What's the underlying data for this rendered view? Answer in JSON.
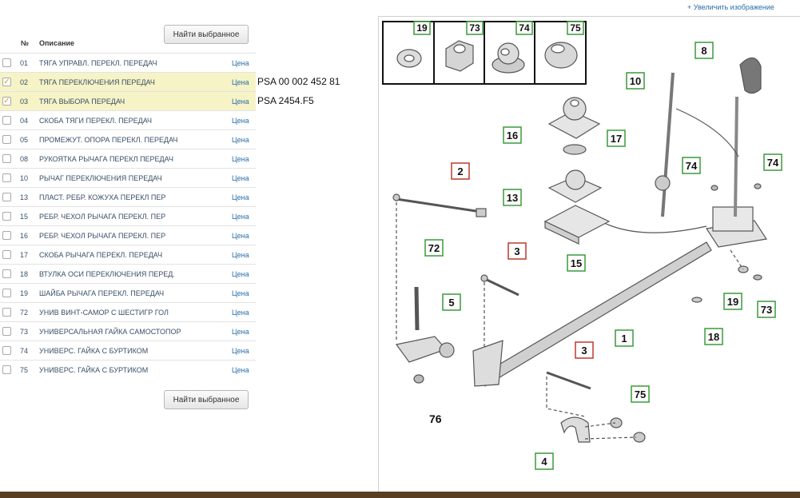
{
  "toolbar": {
    "find_selected": "Найти выбранное"
  },
  "table": {
    "headers": {
      "num": "№",
      "desc": "Описание"
    },
    "rows": [
      {
        "num": "01",
        "desc": "ТЯГА УПРАВЛ. ПЕРЕКЛ. ПЕРЕДАЧ",
        "price": "Цена",
        "checked": false,
        "ref": ""
      },
      {
        "num": "02",
        "desc": "ТЯГА ПЕРЕКЛЮЧЕНИЯ ПЕРЕДАЧ",
        "price": "Цена",
        "checked": true,
        "ref": "PSA 00 002 452 81"
      },
      {
        "num": "03",
        "desc": "ТЯГА ВЫБОРА ПЕРЕДАЧ",
        "price": "Цена",
        "checked": true,
        "ref": "PSA 2454.F5"
      },
      {
        "num": "04",
        "desc": "СКОБА ТЯГИ ПЕРЕКЛ. ПЕРЕДАЧ",
        "price": "Цена",
        "checked": false,
        "ref": ""
      },
      {
        "num": "05",
        "desc": "ПРОМЕЖУТ. ОПОРА ПЕРЕКЛ. ПЕРЕДАЧ",
        "price": "Цена",
        "checked": false,
        "ref": ""
      },
      {
        "num": "08",
        "desc": "РУКОЯТКА РЫЧАГА ПЕРЕКЛ ПЕРЕДАЧ",
        "price": "Цена",
        "checked": false,
        "ref": ""
      },
      {
        "num": "10",
        "desc": "РЫЧАГ ПЕРЕКЛЮЧЕНИЯ ПЕРЕДАЧ",
        "price": "Цена",
        "checked": false,
        "ref": ""
      },
      {
        "num": "13",
        "desc": "ПЛАСТ. РЕБР. КОЖУХА ПЕРЕКЛ ПЕР",
        "price": "Цена",
        "checked": false,
        "ref": ""
      },
      {
        "num": "15",
        "desc": "РЕБР. ЧЕХОЛ РЫЧАГА ПЕРЕКЛ. ПЕР",
        "price": "Цена",
        "checked": false,
        "ref": ""
      },
      {
        "num": "16",
        "desc": "РЕБР. ЧЕХОЛ РЫЧАГА ПЕРЕКЛ. ПЕР",
        "price": "Цена",
        "checked": false,
        "ref": ""
      },
      {
        "num": "17",
        "desc": "СКОБА РЫЧАГА ПЕРЕКЛ. ПЕРЕДАЧ",
        "price": "Цена",
        "checked": false,
        "ref": ""
      },
      {
        "num": "18",
        "desc": "ВТУЛКА ОСИ ПЕРЕКЛЮЧЕНИЯ ПЕРЕД.",
        "price": "Цена",
        "checked": false,
        "ref": ""
      },
      {
        "num": "19",
        "desc": "ШАЙБА РЫЧАГА ПЕРЕКЛ. ПЕРЕДАЧ",
        "price": "Цена",
        "checked": false,
        "ref": ""
      },
      {
        "num": "72",
        "desc": "УНИВ ВИНТ-САМОР С ШЕСТИГР ГОЛ",
        "price": "Цена",
        "checked": false,
        "ref": ""
      },
      {
        "num": "73",
        "desc": "УНИВЕРСАЛЬНАЯ ГАЙКА САМОСТОПОР",
        "price": "Цена",
        "checked": false,
        "ref": ""
      },
      {
        "num": "74",
        "desc": "УНИВЕРС. ГАЙКА С БУРТИКОМ",
        "price": "Цена",
        "checked": false,
        "ref": ""
      },
      {
        "num": "75",
        "desc": "УНИВЕРС. ГАЙКА С БУРТИКОМ",
        "price": "Цена",
        "checked": false,
        "ref": ""
      }
    ]
  },
  "diagram": {
    "zoom_link": "+ Увеличить изображение",
    "inset_labels": [
      "19",
      "73",
      "74",
      "75"
    ],
    "callouts": [
      {
        "id": "8",
        "color": "green"
      },
      {
        "id": "10",
        "color": "green"
      },
      {
        "id": "16",
        "color": "green"
      },
      {
        "id": "17",
        "color": "green"
      },
      {
        "id": "74",
        "color": "green"
      },
      {
        "id": "74",
        "color": "green"
      },
      {
        "id": "2",
        "color": "red"
      },
      {
        "id": "13",
        "color": "green"
      },
      {
        "id": "72",
        "color": "green"
      },
      {
        "id": "3",
        "color": "red"
      },
      {
        "id": "15",
        "color": "green"
      },
      {
        "id": "5",
        "color": "green"
      },
      {
        "id": "19",
        "color": "green"
      },
      {
        "id": "73",
        "color": "green"
      },
      {
        "id": "18",
        "color": "green"
      },
      {
        "id": "1",
        "color": "green"
      },
      {
        "id": "3",
        "color": "red"
      },
      {
        "id": "75",
        "color": "green"
      },
      {
        "id": "4",
        "color": "green"
      }
    ],
    "plain_label": "76"
  },
  "colors": {
    "selected_row": "#f6f3c7",
    "price_link": "#2a6ea8",
    "callout_green": "#3a9a3a",
    "callout_red": "#c0392b"
  }
}
